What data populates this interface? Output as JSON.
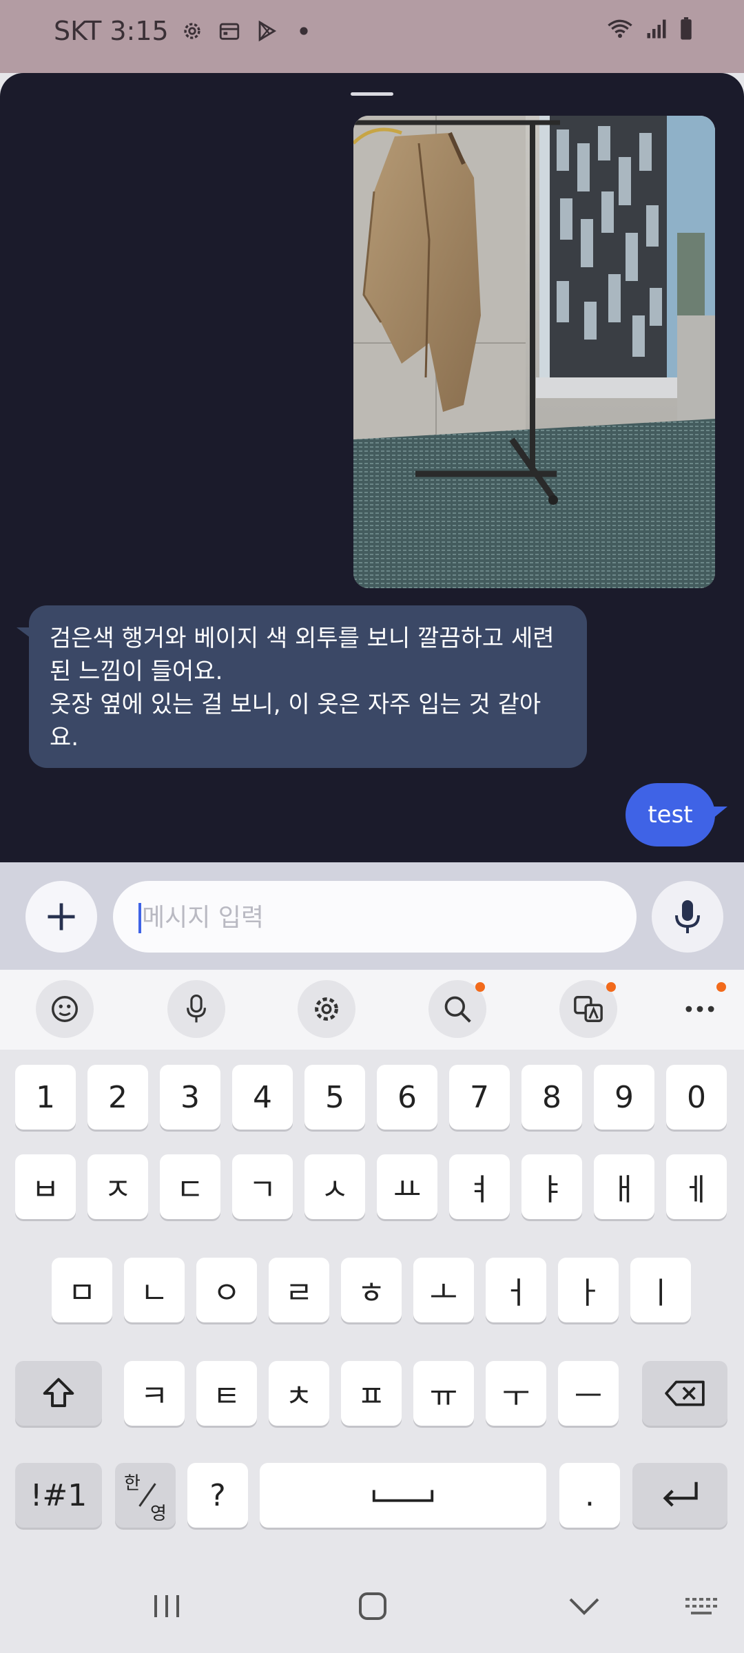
{
  "status_bar": {
    "carrier_time": "SKT 3:15",
    "icons": [
      "gear-icon",
      "calendar-icon",
      "play-store-icon",
      "dot-icon",
      "wifi-icon",
      "signal-icon",
      "battery-icon"
    ]
  },
  "chat": {
    "image_alt": "photo of beige coat on black hanger rack by window",
    "received_message": "검은색 행거와 베이지 색 외투를 보니 깔끔하고 세련된 느낌이 들어요.\n 옷장 옆에 있는 걸 보니, 이 옷은 자주 입는 것 같아요.",
    "sent_message": "test"
  },
  "input": {
    "placeholder": "메시지 입력",
    "value": ""
  },
  "keyboard_toolbar": {
    "items": [
      "emoji-icon",
      "voice-input-icon",
      "settings-icon",
      "search-icon",
      "translate-icon",
      "more-icon"
    ]
  },
  "keyboard": {
    "row_numbers": [
      "1",
      "2",
      "3",
      "4",
      "5",
      "6",
      "7",
      "8",
      "9",
      "0"
    ],
    "row1": [
      "ㅂ",
      "ㅈ",
      "ㄷ",
      "ㄱ",
      "ㅅ",
      "ㅛ",
      "ㅕ",
      "ㅑ",
      "ㅐ",
      "ㅔ"
    ],
    "row2": [
      "ㅁ",
      "ㄴ",
      "ㅇ",
      "ㄹ",
      "ㅎ",
      "ㅗ",
      "ㅓ",
      "ㅏ",
      "ㅣ"
    ],
    "row3": [
      "ㅋ",
      "ㅌ",
      "ㅊ",
      "ㅍ",
      "ㅠ",
      "ㅜ",
      "ㅡ"
    ],
    "symbols_label": "!#1",
    "lang_top": "한",
    "lang_bottom": "영",
    "question": "?",
    "period": "."
  },
  "colors": {
    "chat_bg": "#1b1b2b",
    "received_bubble": "#3b4866",
    "sent_bubble": "#3f63e6",
    "badge": "#f26a1b"
  }
}
